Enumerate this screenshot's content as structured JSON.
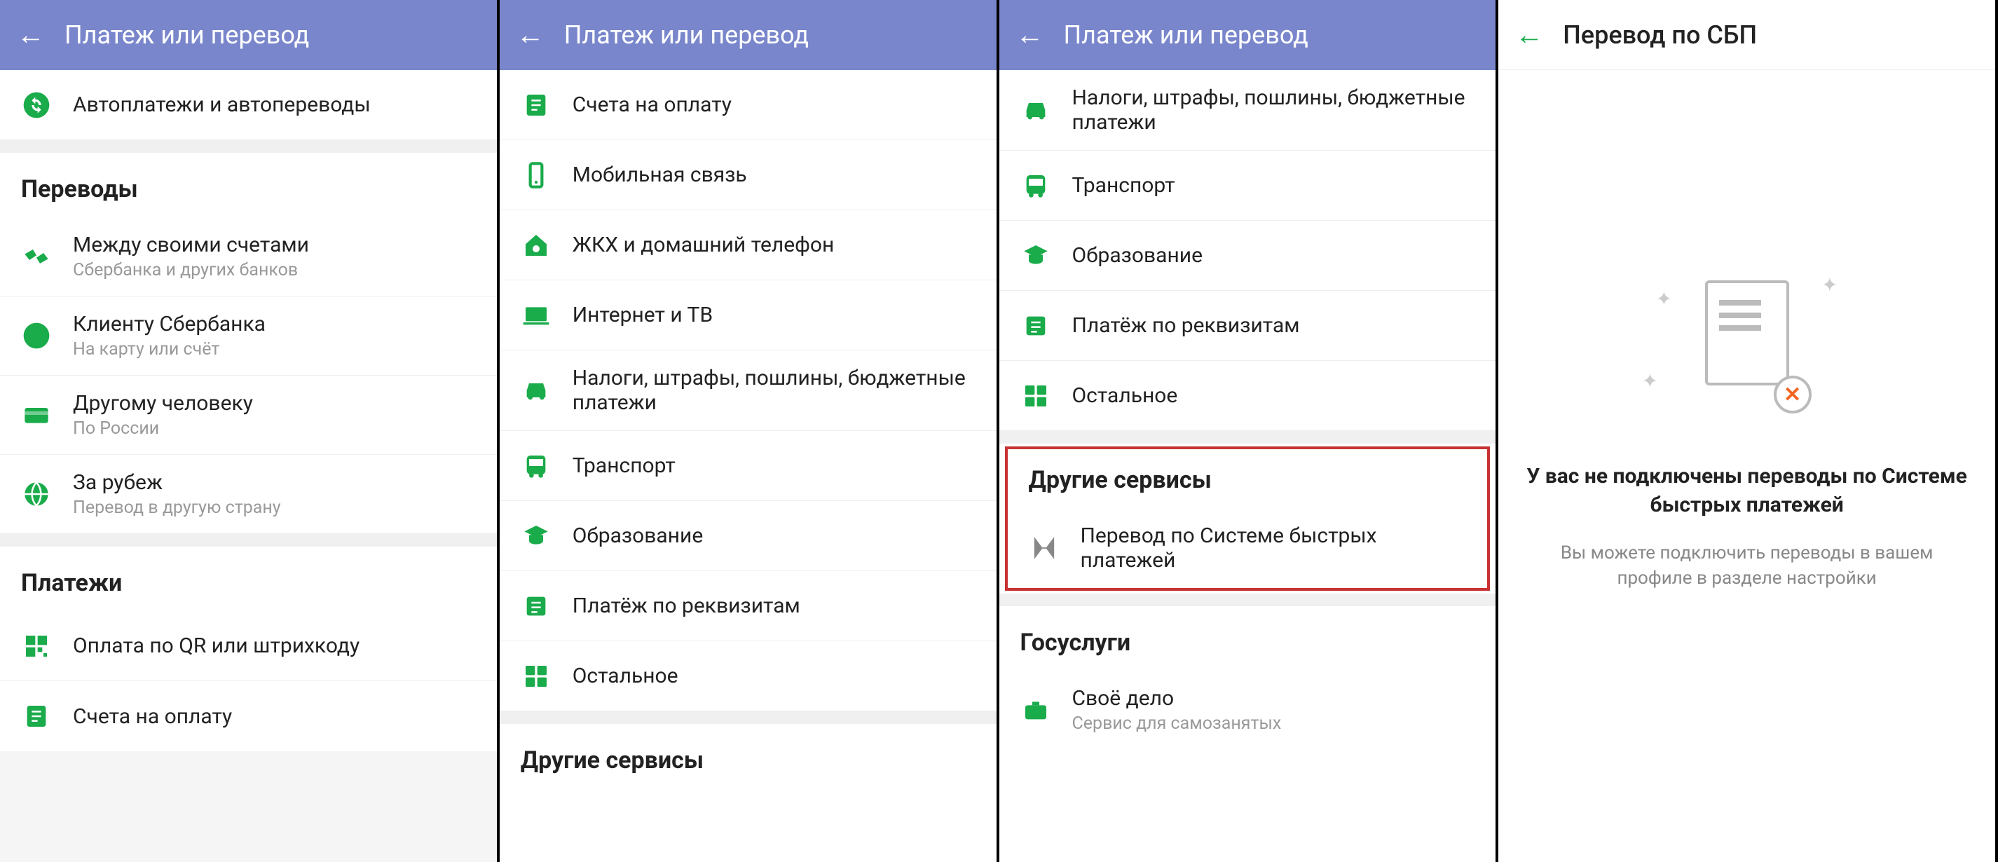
{
  "pane1": {
    "header": {
      "title": "Платеж или перевод"
    },
    "top_item": {
      "label": "Автоплатежи и автопереводы"
    },
    "section_transfers": "Переводы",
    "transfers": [
      {
        "label": "Между своими счетами",
        "sub": "Сбербанка и других банков",
        "icon": "hands-icon"
      },
      {
        "label": "Клиенту Сбербанка",
        "sub": "На карту или счёт",
        "icon": "sber-icon"
      },
      {
        "label": "Другому человеку",
        "sub": "По России",
        "icon": "card-icon"
      },
      {
        "label": "За рубеж",
        "sub": "Перевод в другую страну",
        "icon": "globe-icon"
      }
    ],
    "section_payments": "Платежи",
    "payments": [
      {
        "label": "Оплата по QR или штрихкоду",
        "icon": "qr-icon"
      },
      {
        "label": "Счета на оплату",
        "icon": "invoice-icon"
      }
    ]
  },
  "pane2": {
    "header": {
      "title": "Платеж или перевод"
    },
    "items": [
      {
        "label": "Счета на оплату",
        "icon": "invoice-icon"
      },
      {
        "label": "Мобильная связь",
        "icon": "phone-icon"
      },
      {
        "label": "ЖКХ и домашний телефон",
        "icon": "house-icon"
      },
      {
        "label": "Интернет и ТВ",
        "icon": "laptop-icon"
      },
      {
        "label": "Налоги, штрафы, пошлины, бюджетные платежи",
        "icon": "car-icon"
      },
      {
        "label": "Транспорт",
        "icon": "bus-icon"
      },
      {
        "label": "Образование",
        "icon": "grad-icon"
      },
      {
        "label": "Платёж по реквизитам",
        "icon": "req-icon"
      },
      {
        "label": "Остальное",
        "icon": "other-icon"
      }
    ],
    "section_other": "Другие сервисы"
  },
  "pane3": {
    "header": {
      "title": "Платеж или перевод"
    },
    "items_top": [
      {
        "label": "Налоги, штрафы, пошлины, бюджетные платежи",
        "icon": "car-icon"
      },
      {
        "label": "Транспорт",
        "icon": "bus-icon"
      },
      {
        "label": "Образование",
        "icon": "grad-icon"
      },
      {
        "label": "Платёж по реквизитам",
        "icon": "req-icon"
      },
      {
        "label": "Остальное",
        "icon": "other-icon"
      }
    ],
    "section_other": "Другие сервисы",
    "sbp_item": {
      "label": "Перевод по Системе быстрых платежей",
      "icon": "sbp-icon"
    },
    "section_gos": "Госуслуги",
    "gos_item": {
      "label": "Своё дело",
      "sub": "Сервис для самозанятых",
      "icon": "briefcase-icon"
    }
  },
  "pane4": {
    "header": {
      "title": "Перевод по СБП"
    },
    "empty_title": "У вас не подключены переводы по Системе быстрых платежей",
    "empty_sub": "Вы можете подключить переводы в вашем профиле в разделе настройки"
  }
}
